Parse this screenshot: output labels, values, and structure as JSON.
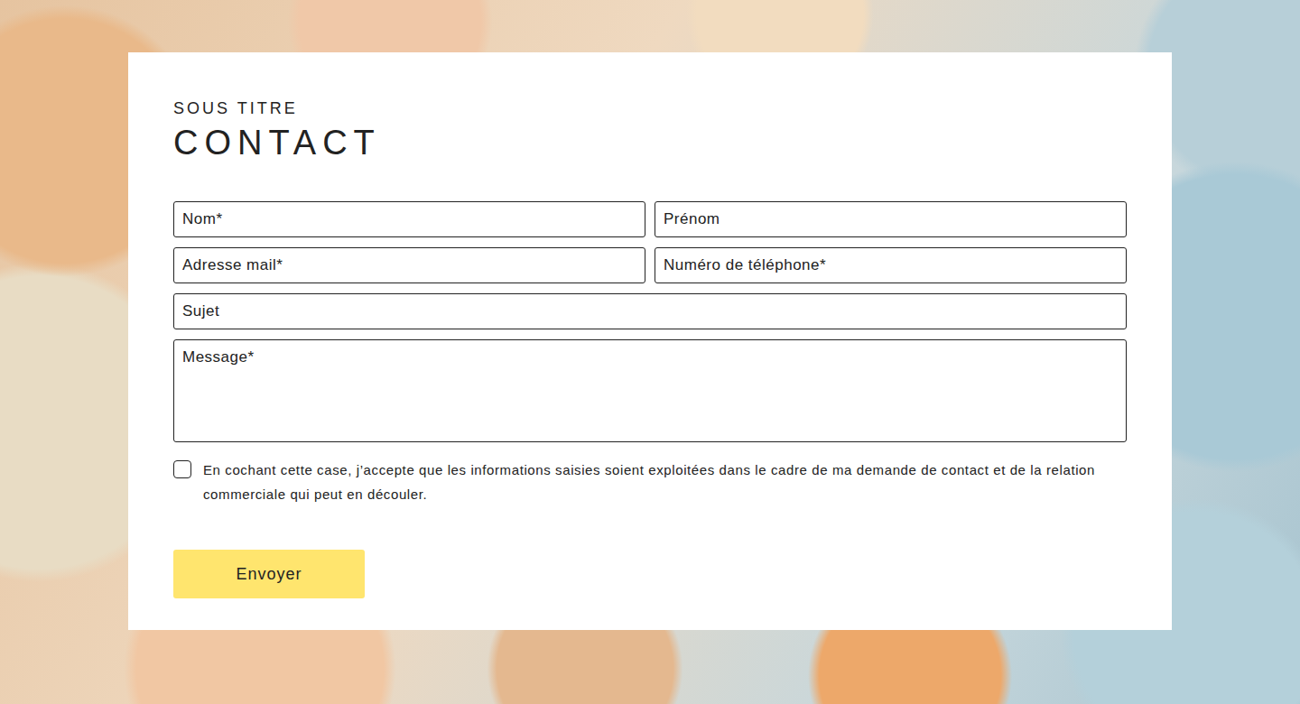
{
  "section": {
    "subtitle": "SOUS TITRE",
    "title": "CONTACT"
  },
  "form": {
    "rows": [
      [
        {
          "placeholder": "Nom*",
          "kind": "input"
        },
        {
          "placeholder": "Prénom",
          "kind": "input"
        }
      ],
      [
        {
          "placeholder": "Adresse mail*",
          "kind": "input"
        },
        {
          "placeholder": "Numéro de téléphone*",
          "kind": "input"
        }
      ],
      [
        {
          "placeholder": "Sujet",
          "kind": "input"
        }
      ],
      [
        {
          "placeholder": "Message*",
          "kind": "textarea"
        }
      ]
    ],
    "consent": {
      "text": "En cochant cette case, j’accepte que les informations saisies soient exploitées dans le cadre de ma demande de contact et de la relation commerciale qui peut en découler.",
      "checked": false
    },
    "submit": "Envoyer"
  }
}
